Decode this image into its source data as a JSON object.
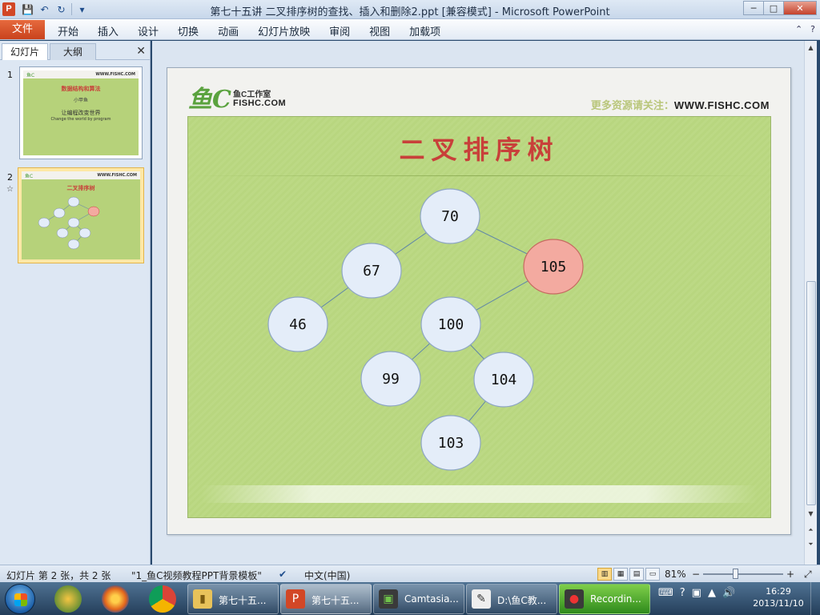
{
  "window": {
    "title": "第七十五讲 二叉排序树的查找、插入和删除2.ppt [兼容模式] - Microsoft PowerPoint",
    "app_icon": "P",
    "minimize": "─",
    "maximize": "□",
    "close": "✕"
  },
  "qat": {
    "save": "💾",
    "undo": "↶",
    "redo": "↻",
    "customize": "▾"
  },
  "ribbon": {
    "file": "文件",
    "tabs": [
      "开始",
      "插入",
      "设计",
      "切换",
      "动画",
      "幻灯片放映",
      "审阅",
      "视图",
      "加载项"
    ],
    "help": "?"
  },
  "panel": {
    "tab_slides": "幻灯片",
    "tab_outline": "大纲",
    "close": "✕",
    "thumbs": [
      {
        "num": "1",
        "title": "数据结构和算法",
        "author": "小甲鱼",
        "line1": "让编程改变世界",
        "line2": "Change the world by program"
      },
      {
        "num": "2",
        "title": "二叉排序树",
        "star": "☆"
      }
    ],
    "thumb_brand": "WWW.FISHC.COM"
  },
  "slide": {
    "logo_mark": "鱼C",
    "logo_name": "鱼C工作室",
    "logo_url": "FISHC.COM",
    "follow_label": "更多资源请关注：",
    "follow_url": "WWW.FISHC.COM",
    "title": "二叉排序树",
    "tree": {
      "nodes": [
        {
          "id": "n70",
          "label": "70"
        },
        {
          "id": "n67",
          "label": "67"
        },
        {
          "id": "n105",
          "label": "105",
          "highlight": true
        },
        {
          "id": "n46",
          "label": "46"
        },
        {
          "id": "n100",
          "label": "100"
        },
        {
          "id": "n99",
          "label": "99"
        },
        {
          "id": "n104",
          "label": "104"
        },
        {
          "id": "n103",
          "label": "103"
        }
      ],
      "edges": [
        [
          "n70",
          "n67"
        ],
        [
          "n70",
          "n105"
        ],
        [
          "n67",
          "n46"
        ],
        [
          "n105",
          "n100"
        ],
        [
          "n100",
          "n99"
        ],
        [
          "n100",
          "n104"
        ],
        [
          "n104",
          "n103"
        ]
      ],
      "node_color": "#e4edf9",
      "highlight_color": "#f3aaa0"
    }
  },
  "status": {
    "slide_info": "幻灯片 第 2 张，共 2 张",
    "theme": "\"1_鱼C视频教程PPT背景模板\"",
    "language": "中文(中国)",
    "zoom": "81%",
    "zoom_minus": "−",
    "zoom_plus": "+"
  },
  "taskbar": {
    "buttons": [
      "第七十五...",
      "第七十五...",
      "Camtasia...",
      "D:\\鱼C教...",
      "Recordin..."
    ],
    "time": "16:29",
    "date": "2013/11/10"
  }
}
